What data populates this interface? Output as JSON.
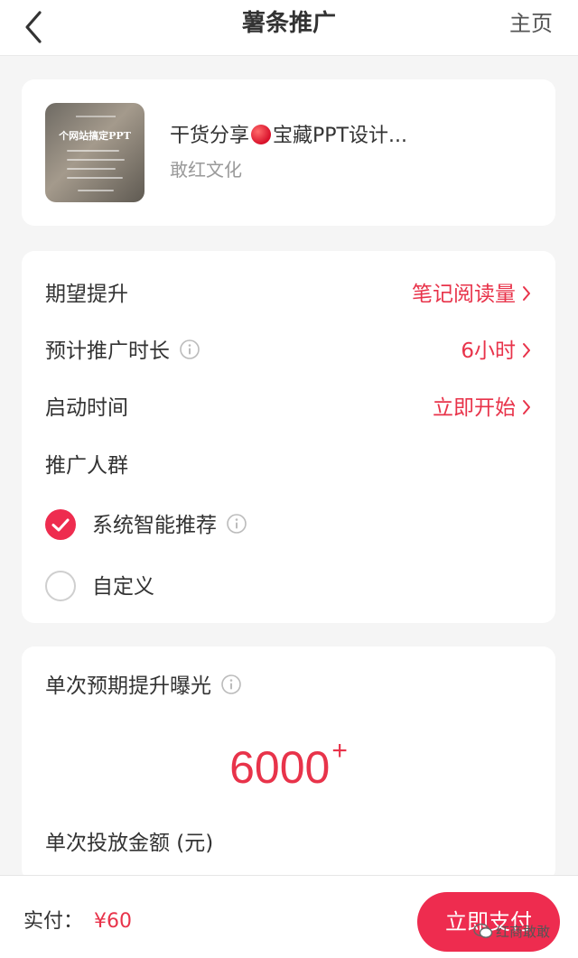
{
  "header": {
    "title": "薯条推广",
    "home_label": "主页"
  },
  "note": {
    "title": "干货分享",
    "title_rest": "宝藏PPT设计...",
    "author": "敢红文化",
    "thumbnail_caption": "个网站搞定PPT"
  },
  "settings": {
    "goal_label": "期望提升",
    "goal_value": "笔记阅读量",
    "duration_label": "预计推广时长",
    "duration_value": "6小时",
    "start_label": "启动时间",
    "start_value": "立即开始",
    "audience_label": "推广人群",
    "audience_options": [
      {
        "label": "系统智能推荐",
        "selected": true
      },
      {
        "label": "自定义",
        "selected": false
      }
    ]
  },
  "budget": {
    "exposure_label": "单次预期提升曝光",
    "exposure_value": "6000",
    "exposure_suffix": "+",
    "amount_label": "单次投放金额 (元)"
  },
  "footer": {
    "pay_label": "实付：",
    "pay_amount": "¥60",
    "pay_button": "立即支付",
    "watermark": "红商敢敢"
  },
  "colors": {
    "accent": "#ee2c4f",
    "accent_text": "#e8334a",
    "background": "#f5f5f5"
  }
}
